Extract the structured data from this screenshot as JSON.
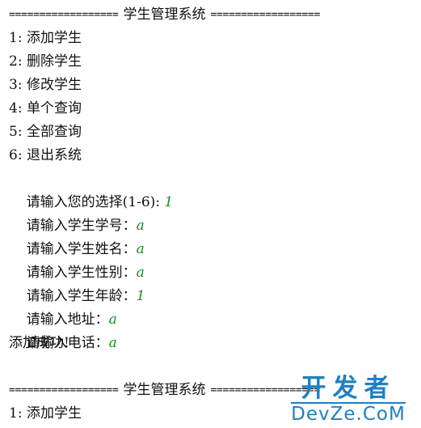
{
  "console": {
    "separator_left": "==================",
    "separator_right": "==================",
    "system_title": "学生管理系统",
    "menu": [
      "1: 添加学生",
      "2: 删除学生",
      "3: 修改学生",
      "4: 单个查询",
      "5: 全部查询",
      "6: 退出系统"
    ],
    "prompts": [
      {
        "label": "请输入您的选择(1-6): ",
        "value": "1"
      },
      {
        "label": "请输入学生学号：",
        "value": "a"
      },
      {
        "label": "请输入学生姓名：",
        "value": "a"
      },
      {
        "label": "请输入学生性别：",
        "value": "a"
      },
      {
        "label": "请输入学生年龄：",
        "value": "1"
      },
      {
        "label": "请输入地址：",
        "value": "a"
      },
      {
        "label": "请输入电话：",
        "value": "a"
      }
    ],
    "result": "添加成功!",
    "second_menu_first": "1: 添加学生"
  },
  "watermark": {
    "cn": "开发者",
    "en": "DevZe.CoM"
  },
  "colors": {
    "input_text": "#1a8a2a",
    "watermark": "#1e7fc8"
  }
}
